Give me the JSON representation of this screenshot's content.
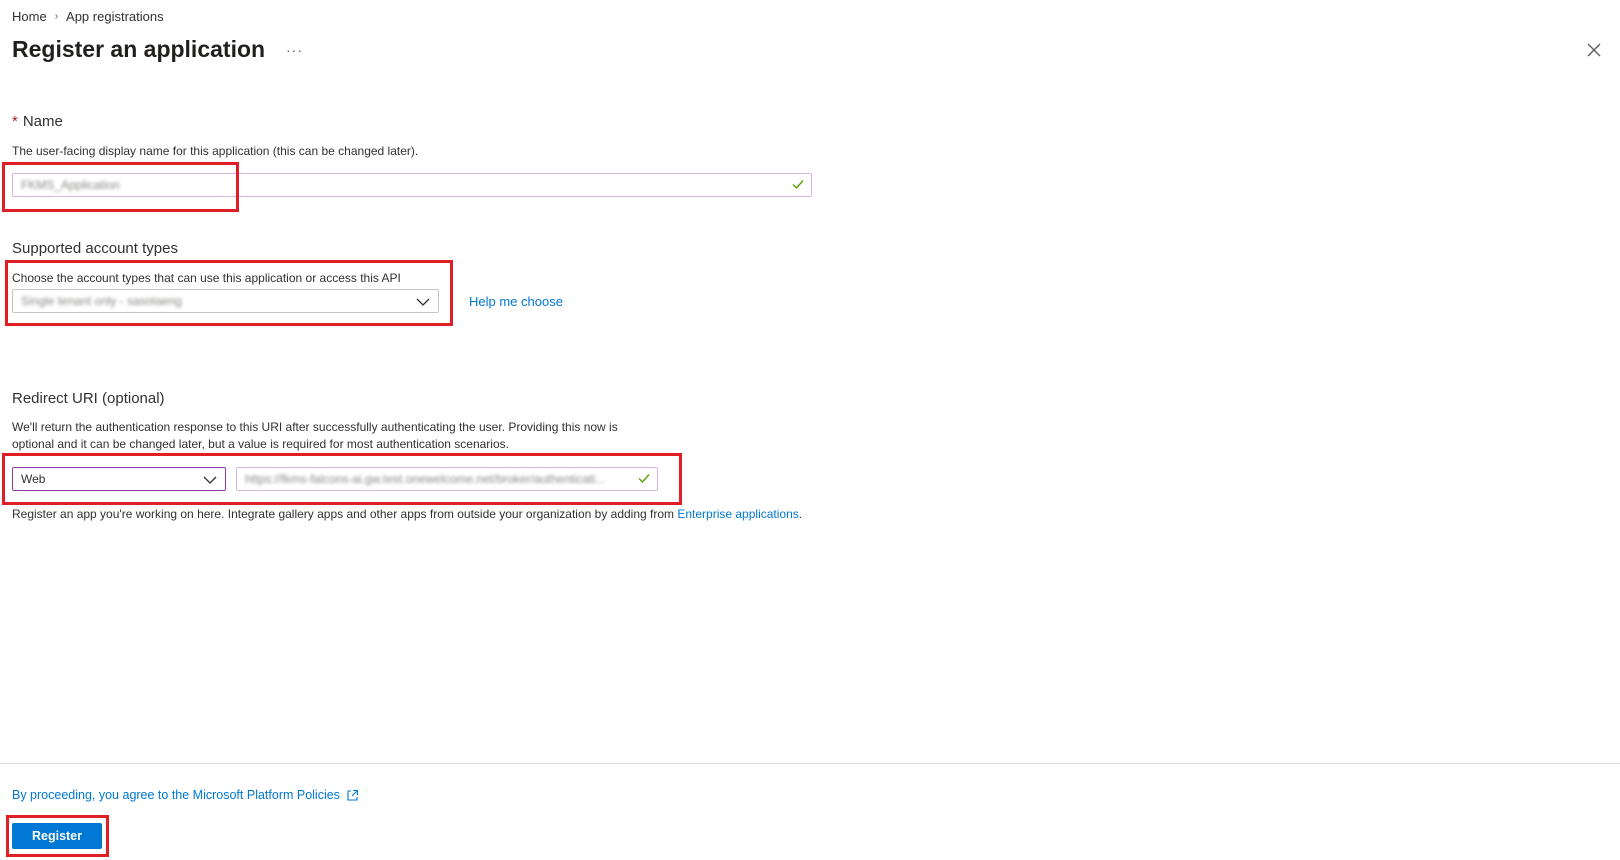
{
  "breadcrumb": {
    "home": "Home",
    "separator": "›",
    "current": "App registrations"
  },
  "page": {
    "title": "Register an application",
    "more": "···"
  },
  "name_section": {
    "required_mark": "*",
    "label": "Name",
    "description": "The user-facing display name for this application (this can be changed later).",
    "value": "FKMS_Application"
  },
  "account_types": {
    "label": "Supported account types",
    "description": "Choose the account types that can use this application or access this API",
    "selected": "Single tenant only - sasolaeng",
    "help_link": "Help me choose"
  },
  "redirect": {
    "label": "Redirect URI (optional)",
    "description_line1": "We'll return the authentication response to this URI after successfully authenticating the user. Providing this now is",
    "description_line2": "optional and it can be changed later, but a value is required for most authentication scenarios.",
    "platform": "Web",
    "uri_value": "https://fkms-falcons-ai.gw.test.onewelcome.net/broker/authenticati...",
    "note_prefix": "Register an app you're working on here. Integrate gallery apps and other apps from outside your organization by adding from ",
    "note_link": "Enterprise applications",
    "note_suffix": "."
  },
  "footer": {
    "policy_text": "By proceeding, you agree to the Microsoft Platform Policies",
    "register_label": "Register"
  },
  "colors": {
    "accent": "#0078d4",
    "highlight": "#e01e25",
    "required": "#a4262c",
    "valid_check": "#57a300"
  }
}
